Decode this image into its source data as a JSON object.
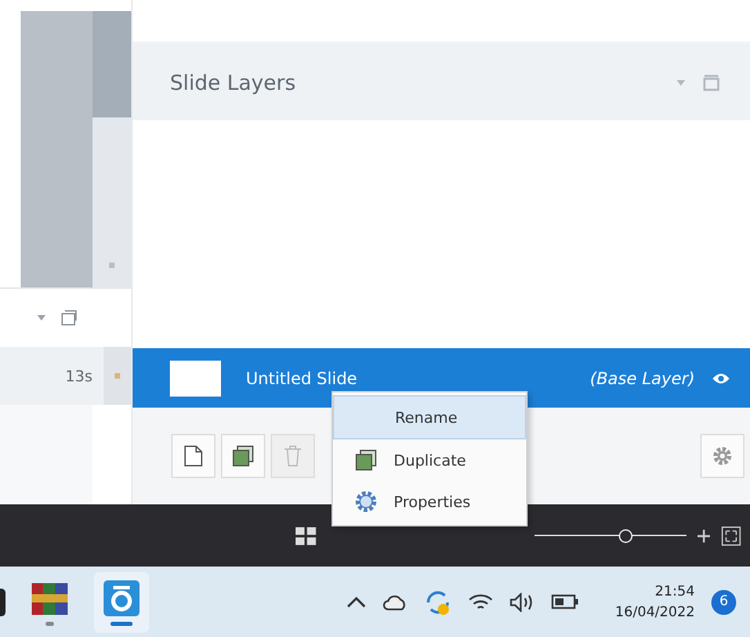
{
  "panel": {
    "title": "Slide Layers"
  },
  "left_panel": {
    "rows": [
      {
        "duration": "13s"
      }
    ]
  },
  "layers": [
    {
      "name": "Untitled Slide",
      "tag": "(Base Layer)",
      "selected": true,
      "visible": true
    }
  ],
  "context_menu": [
    {
      "label": "Rename",
      "highlighted": true
    },
    {
      "label": "Duplicate",
      "highlighted": false
    },
    {
      "label": "Properties",
      "highlighted": false
    }
  ],
  "zoom": {
    "level": 0.6
  },
  "taskbar": {
    "apps": [
      {
        "kind": "archive",
        "selected": false
      },
      {
        "kind": "authoring",
        "selected": true
      }
    ],
    "time": "21:54",
    "date": "16/04/2022",
    "notification_count": "6"
  }
}
